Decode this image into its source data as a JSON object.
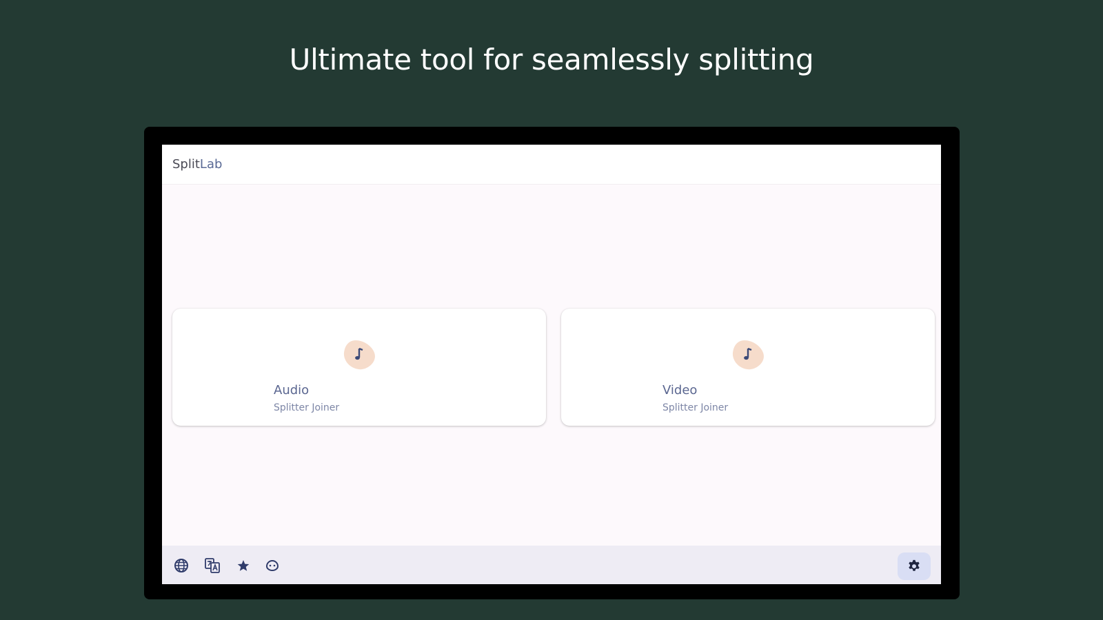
{
  "headline": "Ultimate tool for seamlessly splitting",
  "app": {
    "title_main": "Split",
    "title_accent": "Lab"
  },
  "cards": [
    {
      "title": "Audio",
      "subtitle": "Splitter Joiner",
      "icon": "music-note-icon"
    },
    {
      "title": "Video",
      "subtitle": "Splitter Joiner",
      "icon": "music-note-icon"
    }
  ],
  "bottom_nav": {
    "items": [
      {
        "icon": "globe-icon"
      },
      {
        "icon": "translate-icon"
      },
      {
        "icon": "star-icon"
      },
      {
        "icon": "smiley-icon"
      }
    ],
    "settings_icon": "gear-icon"
  },
  "colors": {
    "background": "#233a33",
    "screen": "#fdf9fc",
    "accent": "#5a6690",
    "blob": "#f6dccb",
    "bottombar": "#eeecf4",
    "settings_bg": "#d9def4"
  }
}
